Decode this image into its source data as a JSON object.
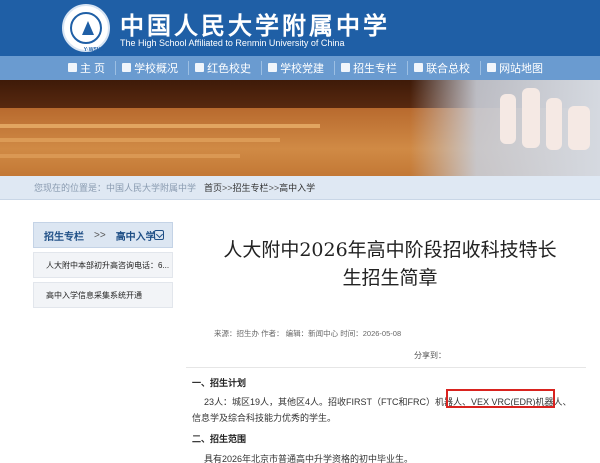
{
  "header": {
    "school_name_cn": "中国人民大学附属中学",
    "school_name_en": "The High School Affiliated to Renmin University of China",
    "logo_text": "Y·WSHO"
  },
  "nav": {
    "items": [
      {
        "label": "主 页",
        "icon": "home-icon"
      },
      {
        "label": "学校概况",
        "icon": "info-icon"
      },
      {
        "label": "红色校史",
        "icon": "flag-icon"
      },
      {
        "label": "学校党建",
        "icon": "party-icon"
      },
      {
        "label": "招生专栏",
        "icon": "enroll-icon"
      },
      {
        "label": "联合总校",
        "icon": "school-icon"
      },
      {
        "label": "网站地图",
        "icon": "map-icon"
      }
    ]
  },
  "breadcrumb": {
    "prefix": "您现在的位置是：中国人民大学附属中学",
    "items": [
      "首页",
      "招生专栏",
      "高中入学"
    ],
    "separator": ">>"
  },
  "sidebar": {
    "section": "招生专栏",
    "separator": ">>",
    "subsection": "高中入学",
    "items": [
      "人大附中本部初升高咨询电话：6...",
      "高中入学信息采集系统开通"
    ]
  },
  "article": {
    "title_line1": "人大附中2026年高中阶段招收科技特长",
    "title_line2": "生招生简章",
    "meta": "来源：招生办 作者：  编辑：新闻中心 时间：2026-05-08",
    "share": "分享到：",
    "section1_title": "一、招生计划",
    "para1_line1": "23人：城区19人，其他区4人。招收FIRST（FTC和FRC）机器人、VEX VRC(EDR)机器人、",
    "para1_line2": "信息学及综合科技能力优秀的学生。",
    "section2_title": "二、招生范围",
    "para2_line1": "具有2026年北京市普通高中升学资格的初中毕业生。"
  },
  "colors": {
    "header_blue": "#1f5fa6",
    "nav_blue": "#6a9bd0",
    "highlight_red": "#d9231f"
  }
}
